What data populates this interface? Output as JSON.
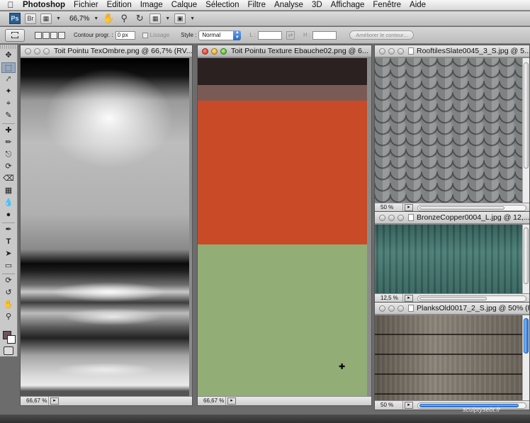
{
  "menubar": {
    "app_name": "Photoshop",
    "items": [
      "Fichier",
      "Edition",
      "Image",
      "Calque",
      "Sélection",
      "Filtre",
      "Analyse",
      "3D",
      "Affichage",
      "Fenêtre",
      "Aide"
    ]
  },
  "appbar": {
    "logo": "Ps",
    "zoom": "66,7%"
  },
  "options": {
    "feather_label": "Contour progr. :",
    "feather_value": "0 px",
    "antialias_label": "Lissage",
    "style_label": "Style :",
    "style_value": "Normal",
    "width_label": "L :",
    "height_label": "H :",
    "refine_label": "Améliorer le contour..."
  },
  "colors": {
    "foreground": "#6e5358",
    "background": "#ffffff",
    "accent_blue": "#2b72d8"
  },
  "documents": {
    "shadow": {
      "title": "Toit Pointu TexOmbre.png @ 66,7% (RV...",
      "zoom": "66,67 %"
    },
    "texture": {
      "title": "Toit Pointu Texture Ebauche02.png @ 6...",
      "zoom": "66,67 %",
      "bands": [
        "#2b2120",
        "#7a5a55",
        "#c94a27",
        "#93ad76"
      ]
    },
    "slate": {
      "title": "RooftilesSlate0045_3_S.jpg @ 5...",
      "zoom": "50 %"
    },
    "copper": {
      "title": "BronzeCopper0004_L.jpg @ 12,...",
      "zoom": "12,5 %"
    },
    "planks": {
      "title": "PlanksOld0017_2_S.jpg @ 50% (R...",
      "zoom": "50 %"
    }
  },
  "watermark": "sculptysebt.fr"
}
